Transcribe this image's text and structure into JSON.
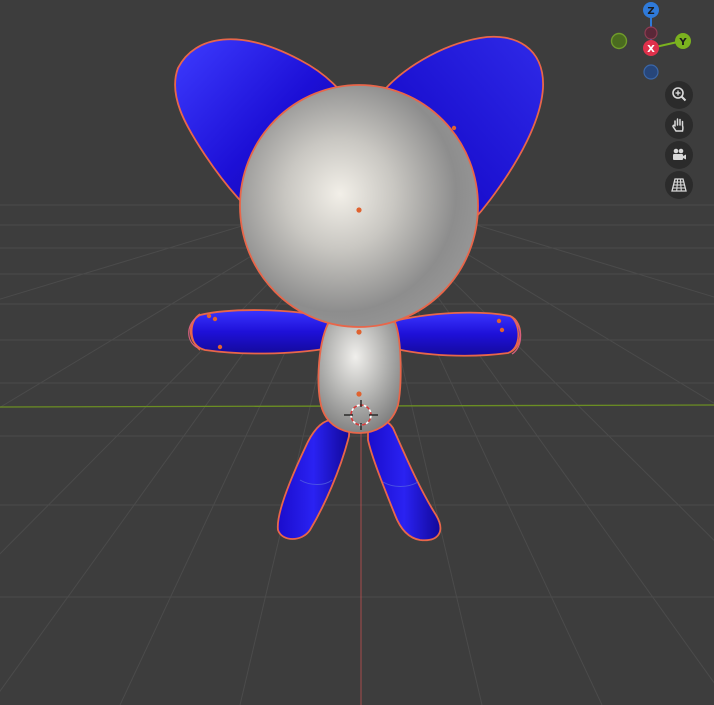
{
  "viewport": {
    "background": "#3d3d3d",
    "grid_color": "#4a4a4a",
    "x_axis_color": "#6b8e23",
    "z_axis_color": "#a84b4b",
    "selection_outline": "#e8664a"
  },
  "gizmo": {
    "z_label": "Z",
    "x_label": "X",
    "y_label": "Y",
    "z_color": "#2f7ad9",
    "x_color": "#e0314b",
    "y_color": "#7bb21f"
  },
  "nav_buttons": [
    {
      "name": "zoom",
      "icon": "zoom-in-icon"
    },
    {
      "name": "pan",
      "icon": "hand-icon"
    },
    {
      "name": "camera",
      "icon": "camera-icon"
    },
    {
      "name": "perspective",
      "icon": "grid-icon"
    }
  ],
  "scene": {
    "objects": [
      "head",
      "body",
      "left-ear",
      "right-ear",
      "left-arm",
      "right-arm",
      "left-leg",
      "right-leg"
    ],
    "body_color": "#b9b9b9",
    "limb_color": "#1f12d6"
  }
}
